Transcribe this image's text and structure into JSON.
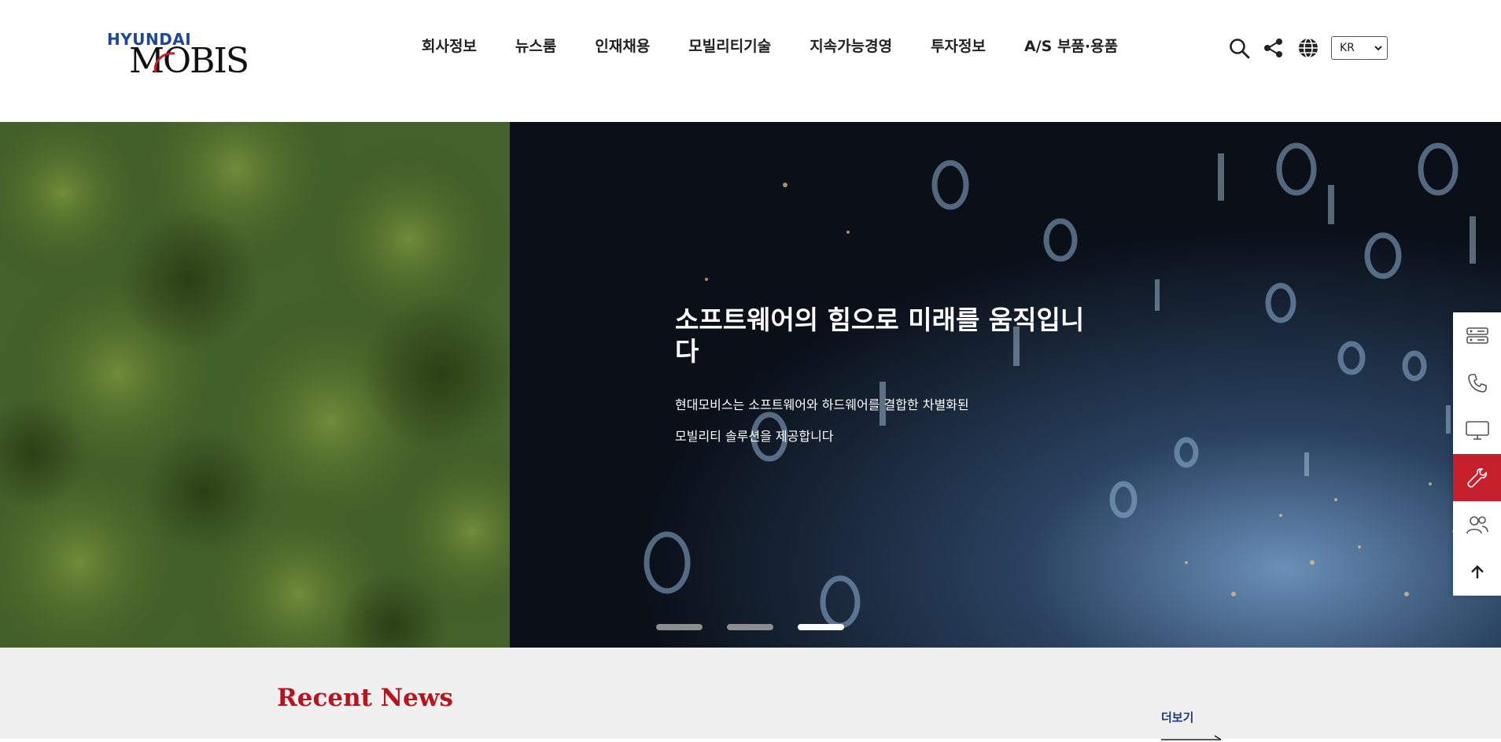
{
  "brand": {
    "logo_top": "HYUNDAI",
    "logo_main": "MOBIS",
    "accent_color": "#c51f2b",
    "primary_color": "#1a4a93"
  },
  "nav": {
    "items": [
      {
        "label": "회사정보"
      },
      {
        "label": "뉴스룸"
      },
      {
        "label": "인재채용"
      },
      {
        "label": "모빌리티기술"
      },
      {
        "label": "지속가능경영"
      },
      {
        "label": "투자정보"
      },
      {
        "label": "A/S 부품·용품"
      }
    ]
  },
  "utilities": {
    "icons": [
      "search-icon",
      "share-icon",
      "globe-icon"
    ],
    "language": {
      "selected": "KR"
    }
  },
  "hero": {
    "title": "소프트웨어의 힘으로 미래를 움직입니다",
    "desc_line1": "현대모비스는 소프트웨어와 하드웨어를 결합한 차별화된",
    "desc_line2": "모빌리티 솔루션을 제공합니다",
    "slides_total": 3,
    "active_slide": 3
  },
  "quick_menu": {
    "items": [
      {
        "icon": "server-icon",
        "active": false
      },
      {
        "icon": "phone-icon",
        "active": false
      },
      {
        "icon": "monitor-icon",
        "active": false
      },
      {
        "icon": "wrench-icon",
        "active": true
      },
      {
        "icon": "users-icon",
        "active": false
      },
      {
        "icon": "arrow-up-icon",
        "active": false
      }
    ]
  },
  "news": {
    "title": "Recent News",
    "more_label": "더보기"
  }
}
